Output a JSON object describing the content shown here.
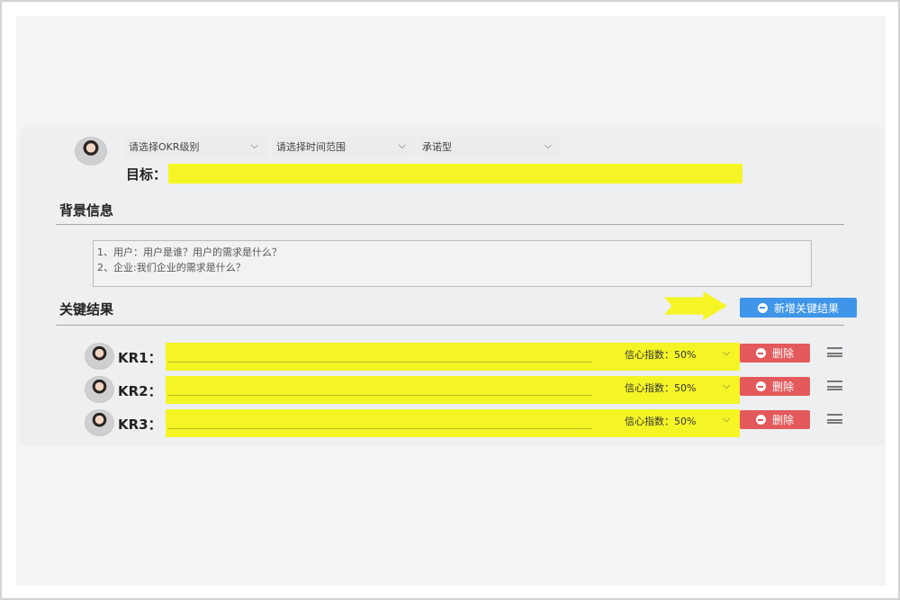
{
  "header": {
    "okr_level_select": "请选择OKR级别",
    "time_range_select": "请选择时间范围",
    "type_select": "承诺型",
    "goal_label": "目标：",
    "goal_value": ""
  },
  "background": {
    "title": "背景信息",
    "lines": [
      "1、用户：用户是谁？用户的需求是什么？",
      "2、企业:我们企业的需求是什么？"
    ]
  },
  "key_results": {
    "title": "关键结果",
    "add_button_label": "新增关键结果",
    "items": [
      {
        "label": "KR1：",
        "value": "",
        "confidence_label": "信心指数：",
        "confidence_value": "50%",
        "delete_label": "删除"
      },
      {
        "label": "KR2：",
        "value": "",
        "confidence_label": "信心指数：",
        "confidence_value": "50%",
        "delete_label": "删除"
      },
      {
        "label": "KR3：",
        "value": "",
        "confidence_label": "信心指数：",
        "confidence_value": "50%",
        "delete_label": "删除"
      }
    ]
  },
  "colors": {
    "highlight": "#f5f526",
    "primary_button": "#3f95e8",
    "danger_button": "#e4595b"
  },
  "icons": [
    "chevron-down-icon",
    "minus-circle-icon",
    "drag-handle-icon",
    "arrow-right-icon"
  ]
}
